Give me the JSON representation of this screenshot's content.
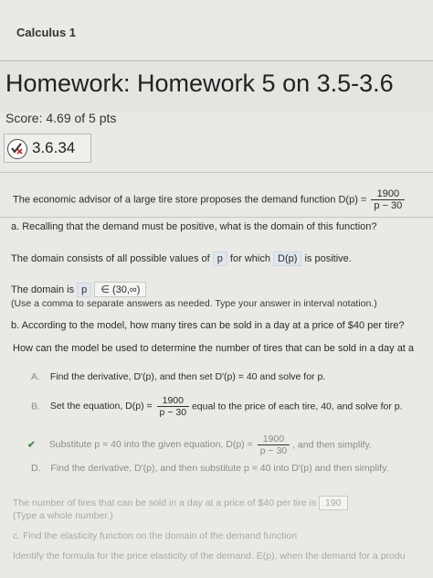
{
  "course": "Calculus 1",
  "homework_title": "Homework: Homework 5 on 3.5-3.6",
  "score": "Score: 4.69 of 5 pts",
  "question_number": "3.6.34",
  "problem": {
    "intro": "The economic advisor of a large tire store proposes the demand function D(p) =",
    "numerator": "1900",
    "denominator": "p − 30"
  },
  "part_a": {
    "question": "a. Recalling that the demand must be positive, what is the domain of this function?",
    "domain_prefix": "The domain consists of all possible values of",
    "p_value": "p",
    "domain_middle": "for which",
    "dp_value": "D(p)",
    "domain_suffix": "is positive.",
    "domain_is": "The domain is",
    "answer_var": "p",
    "answer": "∈ (30,∞)",
    "hint": "(Use a comma to separate answers as needed. Type your answer in interval notation.)"
  },
  "part_b": {
    "question": "b. According to the model, how many tires can be sold in a day at a price of $40 per tire?",
    "sub_question": "How can the model be used to determine the number of tires that can be sold in a day at a",
    "options": [
      {
        "marker": "A.",
        "text": "Find the derivative, D'(p), and then set D'(p) = 40 and solve for p."
      },
      {
        "marker": "B.",
        "text_before": "Set the equation, D(p) =",
        "num": "1900",
        "den": "p − 30",
        "text_after": "equal to the price of each tire, 40, and solve for p."
      },
      {
        "marker": "✔",
        "text_before": "Substitute p = 40 into the given equation, D(p) =",
        "num": "1900",
        "den": "p − 30",
        "text_after": ", and then simplify."
      },
      {
        "marker": "D.",
        "text": "Find the derivative, D'(p), and then substitute p = 40 into D'(p) and then simplify."
      }
    ],
    "result_prefix": "The number of tires that can be sold in a day at a price of $40 per tire is",
    "result_value": "190",
    "result_hint": "(Type a whole number.)"
  },
  "part_c": {
    "question": "c. Find the elasticity function on the domain of the demand function",
    "sub_question": "Identify the formula for the price elasticity of the demand. E(p), when the demand for a produ"
  }
}
